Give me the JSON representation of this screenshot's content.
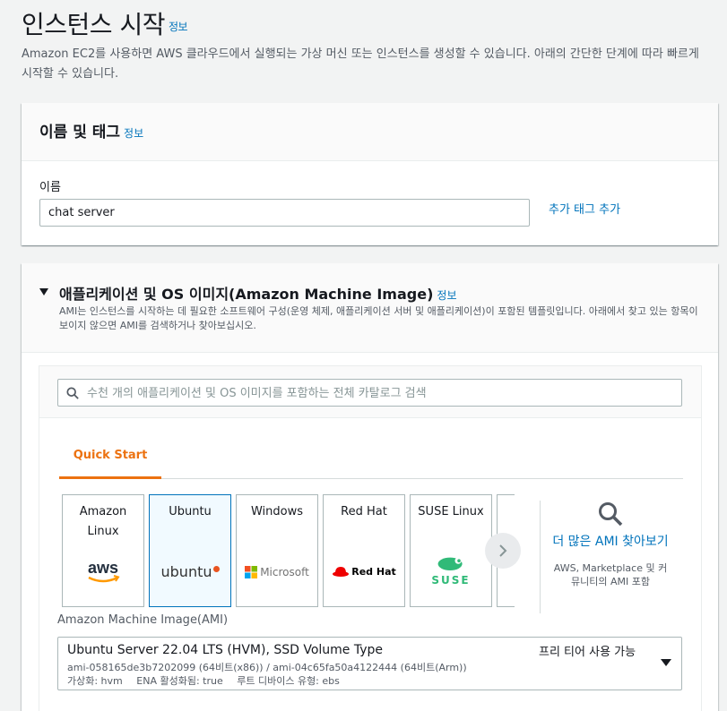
{
  "page": {
    "title": "인스턴스 시작",
    "info": "정보",
    "description": "Amazon EC2를 사용하면 AWS 클라우드에서 실행되는 가상 머신 또는 인스턴스를 생성할 수 있습니다. 아래의 간단한 단계에 따라 빠르게 시작할 수 있습니다."
  },
  "name_tags": {
    "title": "이름 및 태그",
    "info": "정보",
    "name_label": "이름",
    "name_value": "chat server",
    "add_tag": "추가 태그 추가"
  },
  "ami": {
    "title": "애플리케이션 및 OS 이미지(Amazon Machine Image)",
    "info": "정보",
    "description": "AMI는 인스턴스를 시작하는 데 필요한 소프트웨어 구성(운영 체제, 애플리케이션 서버 및 애플리케이션)이 포함된 템플릿입니다. 아래에서 찾고 있는 항목이 보이지 않으면 AMI를 검색하거나 찾아보십시오.",
    "search_placeholder": "수천 개의 애플리케이션 및 OS 이미지를 포함하는 전체 카탈로그 검색",
    "tab": "Quick Start",
    "tiles": [
      {
        "label": "Amazon Linux",
        "logo": "aws-logo"
      },
      {
        "label": "Ubuntu",
        "logo": "ubuntu-logo",
        "selected": true
      },
      {
        "label": "Windows",
        "logo": "microsoft-logo"
      },
      {
        "label": "Red Hat",
        "logo": "redhat-logo"
      },
      {
        "label": "SUSE Linux",
        "logo": "suse-logo"
      }
    ],
    "logos": {
      "aws": "aws",
      "ubuntu": "ubuntu",
      "microsoft": "Microsoft",
      "redhat": "Red Hat",
      "suse": "SUSE"
    },
    "more_link": "더 많은 AMI 찾아보기",
    "more_note": "AWS, Marketplace 및 커뮤니티의 AMI 포함",
    "ami_label": "Amazon Machine Image(AMI)",
    "selected": {
      "name": "Ubuntu Server 22.04 LTS (HVM), SSD Volume Type",
      "free_tier": "프리 티어 사용 가능",
      "ids": "ami-058165de3b7202099 (64비트(x86)) / ami-04c65fa50a4122444 (64비트(Arm))",
      "virtualization": "가상화: hvm",
      "ena": "ENA 활성화됨: true",
      "root_device": "루트 디바이스 유형: ebs"
    }
  },
  "colors": {
    "link": "#0073bb",
    "tab_active": "#ec7211",
    "selected_border": "#0073bb"
  }
}
